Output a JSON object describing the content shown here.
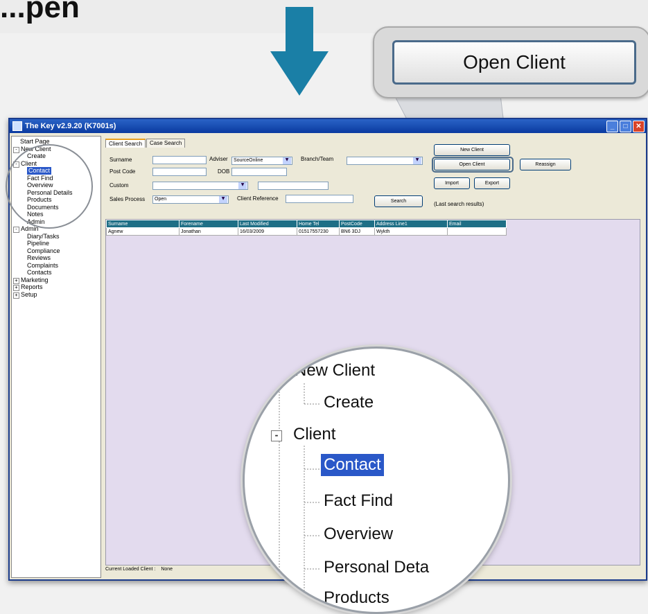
{
  "banner": {
    "heading": "...pen"
  },
  "callout": {
    "button_label": "Open Client"
  },
  "window": {
    "title": "The Key v2.9.20 (K7001s)"
  },
  "tree": {
    "items": [
      {
        "label": "Start Page",
        "depth": 0
      },
      {
        "label": "New Client",
        "depth": 0,
        "expander": "-"
      },
      {
        "label": "Create",
        "depth": 2
      },
      {
        "label": "Client",
        "depth": 0,
        "expander": "-"
      },
      {
        "label": "Contact",
        "depth": 2,
        "selected": true
      },
      {
        "label": "Fact Find",
        "depth": 2
      },
      {
        "label": "Overview",
        "depth": 2
      },
      {
        "label": "Personal Details",
        "depth": 2
      },
      {
        "label": "Products",
        "depth": 2
      },
      {
        "label": "Documents",
        "depth": 2
      },
      {
        "label": "Notes",
        "depth": 2
      },
      {
        "label": "Admin",
        "depth": 2
      },
      {
        "label": "Admin",
        "depth": 0,
        "expander": "-"
      },
      {
        "label": "Diary/Tasks",
        "depth": 2
      },
      {
        "label": "Pipeline",
        "depth": 2
      },
      {
        "label": "Compliance",
        "depth": 2
      },
      {
        "label": "Reviews",
        "depth": 2
      },
      {
        "label": "Complaints",
        "depth": 2
      },
      {
        "label": "Contacts",
        "depth": 2
      },
      {
        "label": "Marketing",
        "depth": 0,
        "expander": "+"
      },
      {
        "label": "Reports",
        "depth": 0,
        "expander": "+"
      },
      {
        "label": "Setup",
        "depth": 0,
        "expander": "+"
      }
    ]
  },
  "search": {
    "tabs": [
      "Client Search",
      "Case Search"
    ],
    "surname_label": "Surname",
    "adviser_label": "Adviser",
    "adviser_value": "SourceOnline",
    "branch_label": "Branch/Team",
    "postcode_label": "Post Code",
    "dob_label": "DOB",
    "custom_label": "Custom",
    "sales_process_label": "Sales Process",
    "sales_process_value": "Open",
    "client_reference_label": "Client Reference",
    "search_button": "Search",
    "new_client_button": "New Client",
    "open_client_button": "Open Client",
    "reassign_button": "Reassign",
    "import_button": "Import",
    "export_button": "Export",
    "last_search_text": "(Last search results)"
  },
  "results": {
    "columns": [
      "Surname",
      "Forename",
      "Last Modified",
      "Home Tel",
      "PostCode",
      "Address Line1",
      "Email"
    ],
    "rows": [
      [
        "Agnew",
        "Jonathan",
        "16/03/2009",
        "01517557230",
        "BN6 3DJ",
        "Wykth",
        ""
      ]
    ]
  },
  "status": {
    "loaded_label": "Current Loaded Client :",
    "loaded_value": "None"
  },
  "magnifier": {
    "items": [
      "New Client",
      "Create",
      "Client",
      "Contact",
      "Fact Find",
      "Overview",
      "Personal Deta",
      "Products"
    ],
    "expander": "-"
  },
  "colors": {
    "arrow": "#1a7fa6",
    "titlebar": "#0a3aa0",
    "selection": "#2a58c8",
    "grid_header": "#1e6f86",
    "results_bg": "#e3dbee"
  }
}
